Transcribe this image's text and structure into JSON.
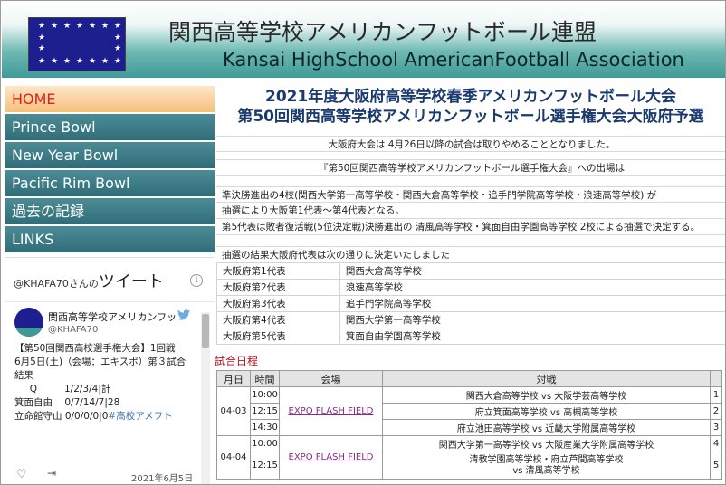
{
  "header": {
    "title_jp": "関西高等学校アメリカンフットボール連盟",
    "title_en": "Kansai HighSchool AmericanFootball Association"
  },
  "nav": {
    "items": [
      {
        "label": "HOME",
        "active": true
      },
      {
        "label": "Prince Bowl",
        "active": false
      },
      {
        "label": "New Year Bowl",
        "active": false
      },
      {
        "label": "Pacific Rim Bowl",
        "active": false
      },
      {
        "label": "過去の記録",
        "active": false
      },
      {
        "label": "LINKS",
        "active": false
      }
    ]
  },
  "twitter": {
    "handle_prefix": "@KHAFA70さんの",
    "heading": "ツイート",
    "info_icon": "i",
    "account_name": "関西高等学校アメリカンフッ",
    "account_handle": "@KHAFA70",
    "tweet_lines": [
      "【第50回関西高校選手権大会】1回戦",
      "6月5日(土)（会場：エキスポ）第３試合",
      "結果",
      "     Q         1/2/3/4|計",
      "箕面自由    0/7/14/7|28",
      "立命館守山    0/0/0/0|0"
    ],
    "tweet_hashtag": "#高校アメフト",
    "tweet_date": "2021年6月5日"
  },
  "main": {
    "event_title_1": "2021年度大阪府高等学校春季アメリカンフットボール大会",
    "event_title_2": "第50回関西高等学校アメリカンフットボール選手権大会大阪府予選",
    "notice_1": "大阪府大会は 4月26日以降の試合は取りやめることとなりました。",
    "notice_2": "『第50回関西高等学校アメリカンフットボール選手権大会』への出場は",
    "notice_3": "準決勝進出の4校(関西大学第一高等学校・関西大倉高等学校・追手門学院高等学校・浪速高等学校) が",
    "notice_4": "抽選により大阪第1代表～第4代表となる。",
    "notice_5": "第5代表は敗者復活戦(5位決定戦)決勝進出の 清風高等学校・箕面自由学園高等学校 2校による抽選で決定する。",
    "notice_6": "抽選の結果大阪府代表は次の通りに決定いたしました",
    "representatives": [
      {
        "rank": "大阪府第1代表",
        "school": "関西大倉高等学校"
      },
      {
        "rank": "大阪府第2代表",
        "school": "浪速高等学校"
      },
      {
        "rank": "大阪府第3代表",
        "school": "追手門学院高等学校"
      },
      {
        "rank": "大阪府第4代表",
        "school": "関西大学第一高等学校"
      },
      {
        "rank": "大阪府第5代表",
        "school": "箕面自由学園高等学校"
      }
    ],
    "schedule_heading": "試合日程",
    "schedule_headers": {
      "date": "月日",
      "time": "時間",
      "venue": "会場",
      "match": "対戦"
    },
    "schedule": [
      {
        "date": "04-03",
        "venue": "EXPO FLASH FIELD",
        "games": [
          {
            "time": "10:00",
            "match": "関西大倉高等学校 vs 大阪学芸高等学校",
            "no": "1"
          },
          {
            "time": "12:15",
            "match": "府立箕面高等学校 vs 高槻高等学校",
            "no": "2"
          },
          {
            "time": "14:30",
            "match": "府立池田高等学校 vs 近畿大学附属高等学校",
            "no": "3"
          }
        ]
      },
      {
        "date": "04-04",
        "venue": "EXPO FLASH FIELD",
        "games": [
          {
            "time": "10:00",
            "match": "関西大学第一高等学校 vs 大阪産業大学附属高等学校",
            "no": "4"
          },
          {
            "time": "12:15",
            "match": "清教学園高等学校・府立芦間高等学校",
            "match2": "vs 清風高等学校",
            "no": "5"
          }
        ]
      }
    ]
  }
}
